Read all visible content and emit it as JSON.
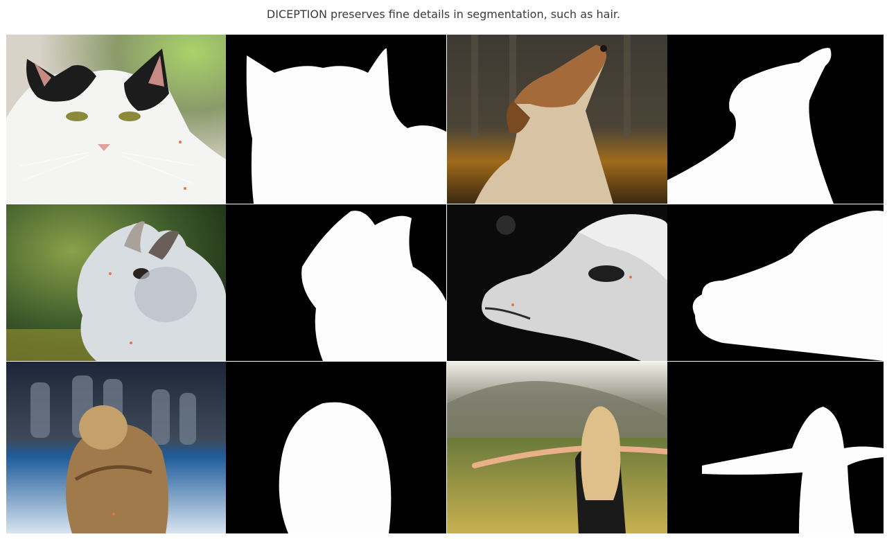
{
  "caption": "DICEPTION preserves fine details in segmentation, such as hair.",
  "rows": [
    {
      "subject": "cat",
      "photo_icon": "cat-photo",
      "mask_icon": "cat-mask"
    },
    {
      "subject": "dog",
      "photo_icon": "dog-photo",
      "mask_icon": "dog-mask"
    },
    {
      "subject": "rabbit",
      "photo_icon": "rabbit-photo",
      "mask_icon": "rabbit-mask"
    },
    {
      "subject": "alpaca",
      "photo_icon": "alpaca-photo",
      "mask_icon": "alpaca-mask"
    },
    {
      "subject": "woman-hair-bun",
      "photo_icon": "hair-bun-photo",
      "mask_icon": "hair-bun-mask"
    },
    {
      "subject": "woman-long-hair",
      "photo_icon": "long-hair-photo",
      "mask_icon": "long-hair-mask"
    }
  ],
  "colors": {
    "mask_background": "#000000",
    "mask_foreground": "#ffffff",
    "point_marker": "#e8744a"
  }
}
